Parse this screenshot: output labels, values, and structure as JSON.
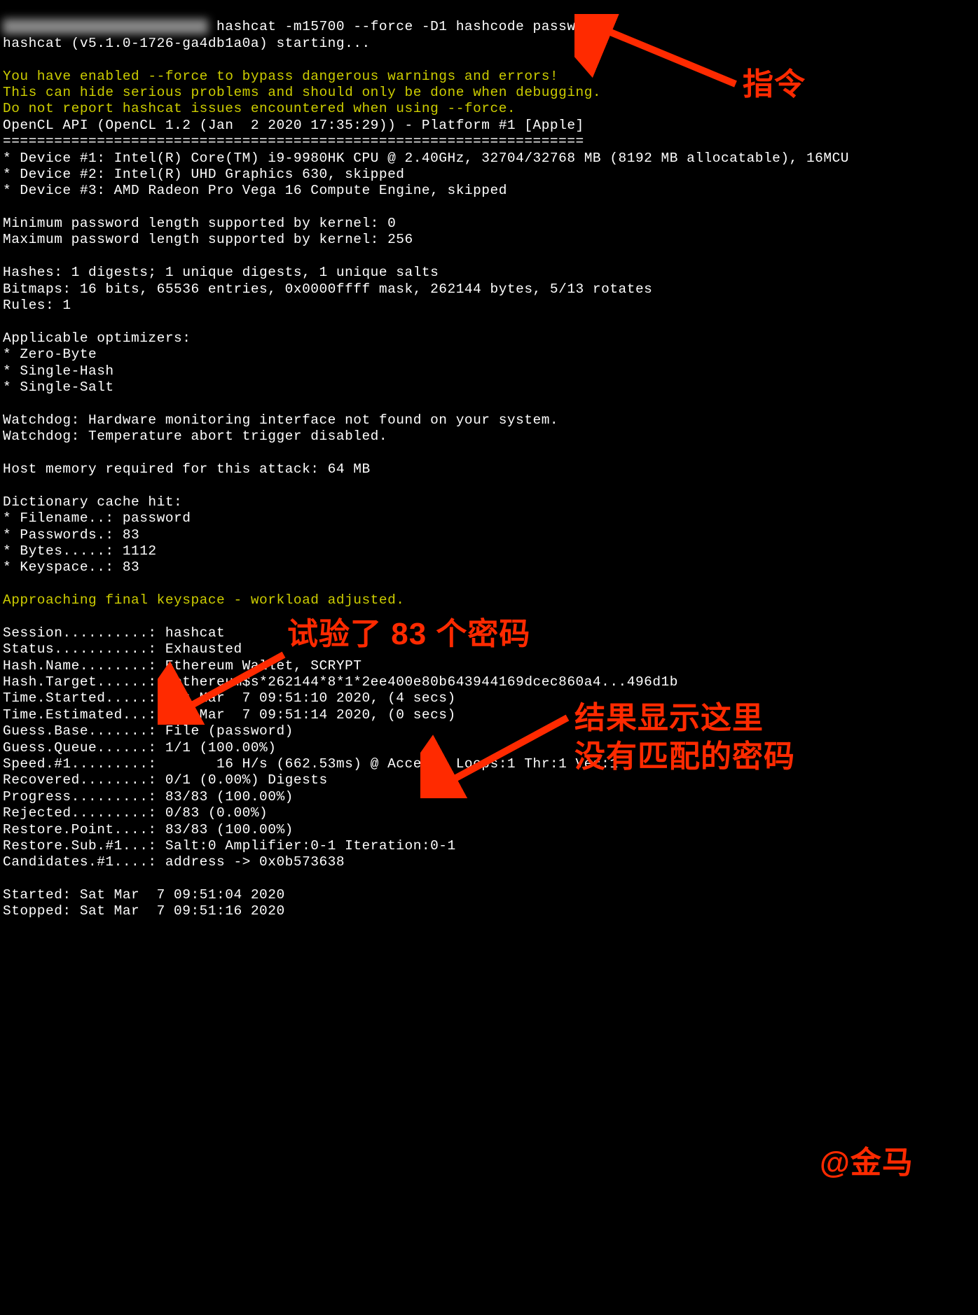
{
  "cmd": {
    "prefix_hidden": "████████████████████████",
    "command": " hashcat -m15700 --force -D1 hashcode password"
  },
  "start_line": "hashcat (v5.1.0-1726-ga4db1a0a) starting...",
  "warn1": "You have enabled --force to bypass dangerous warnings and errors!",
  "warn2": "This can hide serious problems and should only be done when debugging.",
  "warn3": "Do not report hashcat issues encountered when using --force.",
  "api_line": "OpenCL API (OpenCL 1.2 (Jan  2 2020 17:35:29)) - Platform #1 [Apple]",
  "divider": "====================================================================",
  "dev1": "* Device #1: Intel(R) Core(TM) i9-9980HK CPU @ 2.40GHz, 32704/32768 MB (8192 MB allocatable), 16MCU",
  "dev2": "* Device #2: Intel(R) UHD Graphics 630, skipped",
  "dev3": "* Device #3: AMD Radeon Pro Vega 16 Compute Engine, skipped",
  "min_len": "Minimum password length supported by kernel: 0",
  "max_len": "Maximum password length supported by kernel: 256",
  "hashes": "Hashes: 1 digests; 1 unique digests, 1 unique salts",
  "bitmaps": "Bitmaps: 16 bits, 65536 entries, 0x0000ffff mask, 262144 bytes, 5/13 rotates",
  "rules": "Rules: 1",
  "opt_hdr": "Applicable optimizers:",
  "opt1": "* Zero-Byte",
  "opt2": "* Single-Hash",
  "opt3": "* Single-Salt",
  "watch1": "Watchdog: Hardware monitoring interface not found on your system.",
  "watch2": "Watchdog: Temperature abort trigger disabled.",
  "hostmem": "Host memory required for this attack: 64 MB",
  "dict_hdr": "Dictionary cache hit:",
  "dict_file": "* Filename..: password",
  "dict_pass": "* Passwords.: 83",
  "dict_bytes": "* Bytes.....: 1112",
  "dict_keys": "* Keyspace..: 83",
  "approach": "Approaching final keyspace - workload adjusted.",
  "s_session": "Session..........: hashcat",
  "s_status": "Status...........: Exhausted",
  "s_hashname": "Hash.Name........: Ethereum Wallet, SCRYPT",
  "s_hashtarget": "Hash.Target......: $ethereum$s*262144*8*1*2ee400e80b643944169dcec860a4...496d1b",
  "s_timestart": "Time.Started.....: Sat Mar  7 09:51:10 2020, (4 secs)",
  "s_timeest": "Time.Estimated...: Sat Mar  7 09:51:14 2020, (0 secs)",
  "s_guessb": "Guess.Base.......: File (password)",
  "s_guessq": "Guess.Queue......: 1/1 (100.00%)",
  "s_speed": "Speed.#1.........:       16 H/s (662.53ms) @ Accel:1 Loops:1 Thr:1 Vec:1",
  "s_recovered": "Recovered........: 0/1 (0.00%) Digests",
  "s_progress": "Progress.........: 83/83 (100.00%)",
  "s_rejected": "Rejected.........: 0/83 (0.00%)",
  "s_restorep": "Restore.Point....: 83/83 (100.00%)",
  "s_restores": "Restore.Sub.#1...: Salt:0 Amplifier:0-1 Iteration:0-1",
  "s_cand": "Candidates.#1....: address -> 0x0b573638",
  "started": "Started: Sat Mar  7 09:51:04 2020",
  "stopped": "Stopped: Sat Mar  7 09:51:16 2020",
  "anno_cmd": "指令",
  "anno_pass": "试验了 83 个密码",
  "anno_result1": "结果显示这里",
  "anno_result2": "没有匹配的密码",
  "anno_sig": "@金马"
}
